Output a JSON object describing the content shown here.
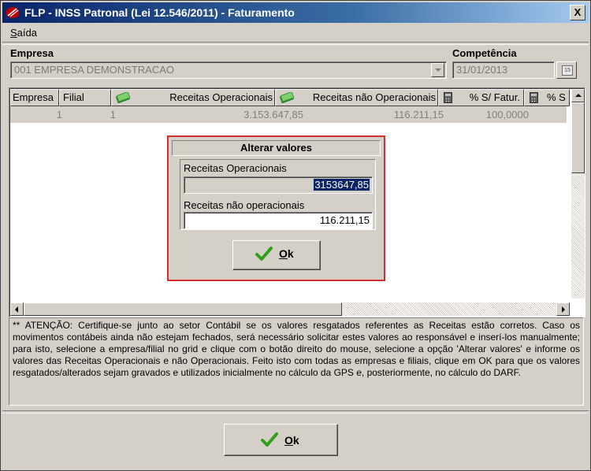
{
  "window": {
    "title": "FLP - INSS Patronal (Lei 12.546/2011) - Faturamento",
    "close_label": "X"
  },
  "menu": {
    "saida_first": "S",
    "saida_rest": "aída"
  },
  "form": {
    "empresa_label": "Empresa",
    "empresa_value": "001 EMPRESA DEMONSTRACAO",
    "competencia_label": "Competência",
    "competencia_value": "31/01/2013",
    "calendar_glyph": "15"
  },
  "grid": {
    "headers": {
      "empresa": "Empresa",
      "filial": "Filial",
      "receitas_op": "Receitas Operacionais",
      "receitas_nao_op": "Receitas não Operacionais",
      "perc_fatur": "% S/ Fatur.",
      "perc_s2": "% S"
    },
    "rows": [
      {
        "empresa": "1",
        "filial": "1",
        "receitas_op": "3.153.647,85",
        "receitas_nao_op": "116.211,15",
        "perc_fatur": "100,0000"
      }
    ]
  },
  "dialog": {
    "title": "Alterar valores",
    "receitas_op_label": "Receitas Operacionais",
    "receitas_op_value": "3153647,85",
    "receitas_nao_op_label": "Receitas não operacionais",
    "receitas_nao_op_value": "116.211,15",
    "ok_first": "O",
    "ok_rest": "k"
  },
  "notice": {
    "text": "** ATENÇÃO: Certifique-se junto ao setor Contábil se os valores resgatados referentes as Receitas estão corretos. Caso os movimentos contábeis ainda não estejam fechados, será necessário solicitar estes valores ao responsável e inserí-los manualmente; para isto, selecione a empresa/filial no grid e clique com o botão direito do mouse, selecione a opção 'Alterar valores' e informe os valores das Receitas Operacionais e não Operacionais. Feito isto com todas as empresas e filiais, clique em OK para que os valores resgatados/alterados sejam gravados e utilizados inicialmente no cálculo da GPS e, posteriormente, no cálculo do DARF."
  },
  "footer": {
    "ok_first": "O",
    "ok_rest": "k"
  },
  "colors": {
    "titlebar_start": "#0a246a",
    "dialog_border": "#d03030",
    "check_green": "#2f9e1a"
  }
}
